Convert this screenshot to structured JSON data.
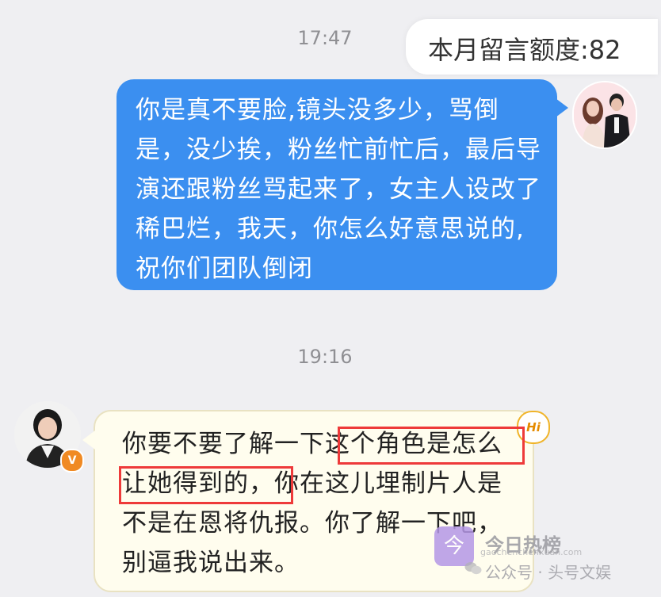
{
  "quota": {
    "text": "本月留言额度:82"
  },
  "timestamps": [
    "17:47",
    "19:16"
  ],
  "messages": {
    "sent": "你是真不要脸,镜头没多少，骂倒是，没少挨，粉丝忙前忙后，最后导演还跟粉丝骂起来了，女主人设改了稀巴烂，我天，你怎么好意思说的,祝你们团队倒闭",
    "received": {
      "part1": "你要不要了解一下",
      "highlight1": "这个角色是怎",
      "highlight2": "么让她得到的",
      "part2": "，你在这儿埋制片人是不是在恩将仇报。你了解一下吧，别逼我说出来。"
    }
  },
  "badges": {
    "hi": "Hi",
    "verified": "V"
  },
  "watermark": {
    "title": "今日热榜",
    "logo_char": "今",
    "url": "gaochenchenxuan.com",
    "account": "公众号 · 头号文娱"
  },
  "colors": {
    "sent_bubble": "#3b8ff0",
    "received_bubble": "#fffdee",
    "highlight_border": "#ee3a3a",
    "background": "#efeff2"
  }
}
